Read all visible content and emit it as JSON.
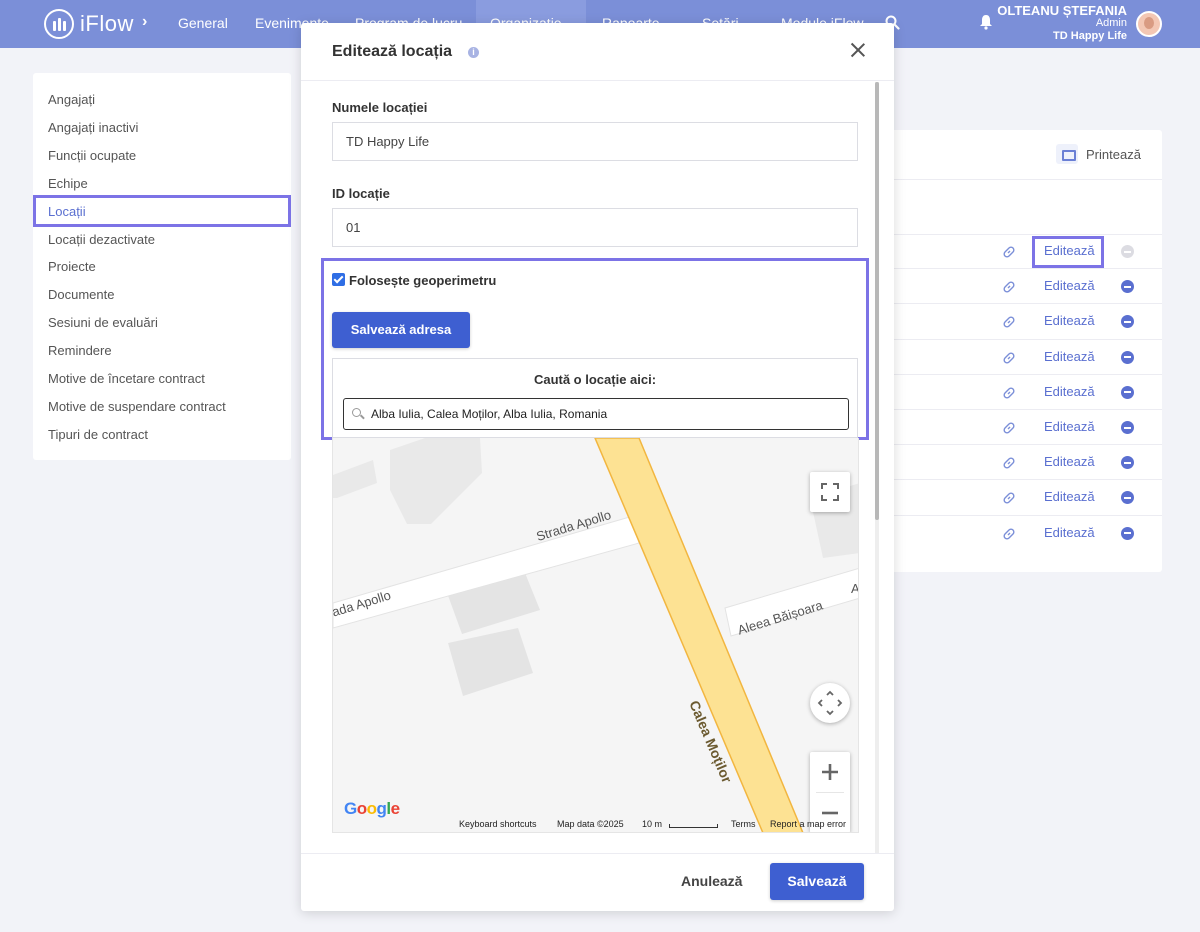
{
  "app": {
    "logo": "iFlow",
    "breadcrumb_arrow": "›"
  },
  "nav": {
    "items": [
      "General",
      "Evenimente",
      "Program de lucru",
      "Organizație",
      "Rapoarte",
      "Setări",
      "Module iFlow"
    ],
    "active": "Organizație"
  },
  "user": {
    "name": "OLTEANU ȘTEFANIA",
    "role": "Admin",
    "company": "TD Happy Life"
  },
  "leftmenu": {
    "items": [
      "Angajați",
      "Angajați inactivi",
      "Funcții ocupate",
      "Echipe",
      "Locații",
      "Locații dezactivate",
      "Proiecte",
      "Documente",
      "Sesiuni de evaluări",
      "Remindere",
      "Motive de încetare contract",
      "Motive de suspendare contract",
      "Tipuri de contract"
    ],
    "active": "Locații"
  },
  "panel": {
    "print_label": "Printează",
    "edit_label": "Editează",
    "rows": 9
  },
  "modal": {
    "title": "Editează locația",
    "name_label": "Numele locației",
    "name_value": "TD Happy Life",
    "id_label": "ID locație",
    "id_value": "01",
    "geofence_label": "Folosește geoperimetru",
    "geofence_checked": true,
    "save_address": "Salvează adresa",
    "search_title": "Caută o locație aici:",
    "search_value": "Alba Iulia, Calea Moților, Alba Iulia, Romania",
    "cancel": "Anulează",
    "save": "Salvează"
  },
  "map": {
    "streets": [
      "Strada Apollo",
      "ada Apollo",
      "Aleea Băișoara",
      "A",
      "Calea Moților"
    ],
    "footer": {
      "shortcuts": "Keyboard shortcuts",
      "map_data": "Map data ©2025",
      "scale": "10 m",
      "terms": "Terms",
      "report": "Report a map error"
    },
    "google": "Google"
  },
  "colors": {
    "navbar": "#7b8fd8",
    "primary": "#3e5fd1",
    "highlight": "#7c73e6",
    "road": "#fde293"
  }
}
